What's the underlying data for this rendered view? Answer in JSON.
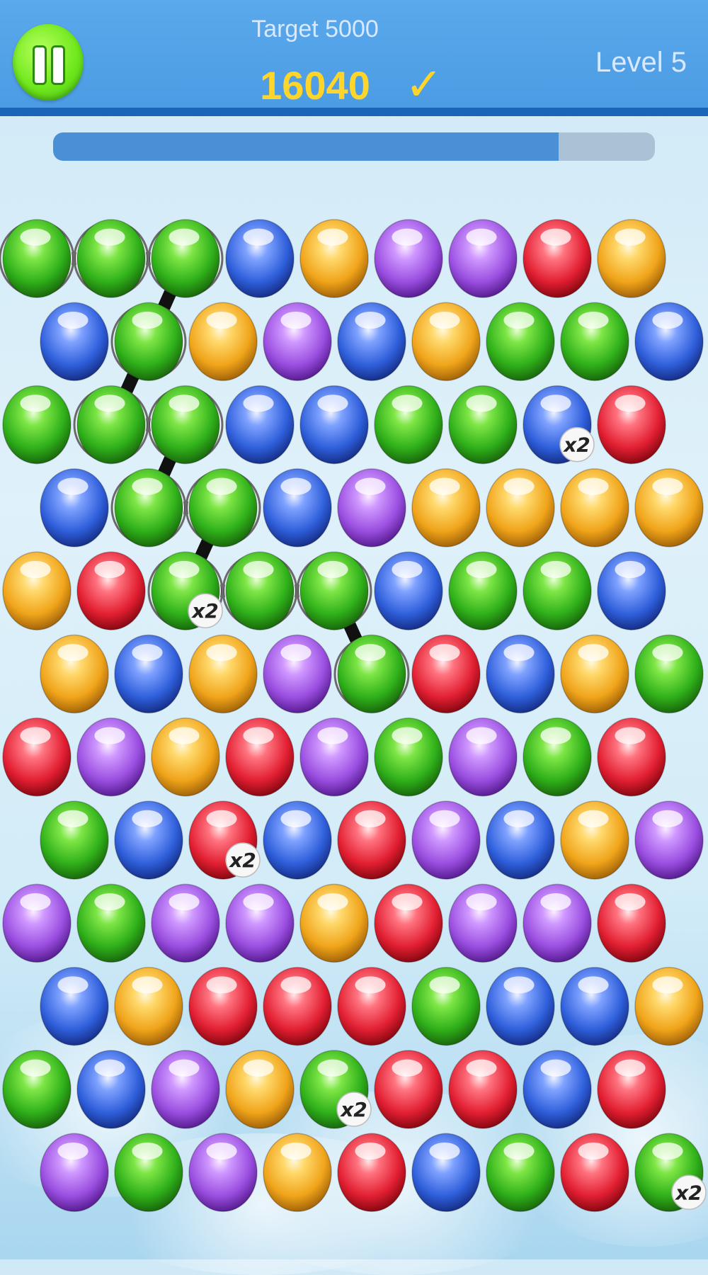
{
  "header": {
    "target_label": "Target 5000",
    "score": "16040",
    "check_symbol": "✓",
    "level_label": "Level 5",
    "pause_icon": "pause-icon"
  },
  "progress": {
    "fraction": 0.84
  },
  "colors": {
    "header_bg": "#4c9ce4",
    "header_border": "#1c64b8",
    "score": "#ffd52a",
    "progress_fill": "#4a90d6",
    "progress_track": "#a9c2d6",
    "green": "#3fbf1f",
    "blue": "#3f6fe0",
    "yellow": "#f2b92a",
    "purple": "#a85ee6",
    "red": "#e83040"
  },
  "board": {
    "rows": [
      [
        "g",
        "g",
        "g",
        "b",
        "y",
        "p",
        "p",
        "r",
        "y"
      ],
      [
        "b",
        "g",
        "y",
        "p",
        "b",
        "y",
        "g",
        "g",
        "b"
      ],
      [
        "g",
        "g",
        "g",
        "b",
        "b",
        "g",
        "g",
        "b",
        "r"
      ],
      [
        "b",
        "g",
        "g",
        "b",
        "p",
        "y",
        "y",
        "y",
        "y"
      ],
      [
        "y",
        "r",
        "g",
        "g",
        "g",
        "b",
        "g",
        "g",
        "b"
      ],
      [
        "y",
        "b",
        "y",
        "p",
        "g",
        "r",
        "b",
        "y",
        "g"
      ],
      [
        "r",
        "p",
        "y",
        "r",
        "p",
        "g",
        "p",
        "g",
        "r"
      ],
      [
        "g",
        "b",
        "r",
        "b",
        "r",
        "p",
        "b",
        "y",
        "p"
      ],
      [
        "p",
        "g",
        "p",
        "p",
        "y",
        "r",
        "p",
        "p",
        "r"
      ],
      [
        "b",
        "y",
        "r",
        "r",
        "r",
        "g",
        "b",
        "b",
        "y"
      ],
      [
        "g",
        "b",
        "p",
        "y",
        "g",
        "r",
        "r",
        "b",
        "r"
      ],
      [
        "p",
        "g",
        "p",
        "y",
        "r",
        "b",
        "g",
        "r",
        "g"
      ]
    ],
    "multiplier_label": "x2",
    "multipliers": [
      [
        2,
        7
      ],
      [
        4,
        2
      ],
      [
        7,
        2
      ],
      [
        10,
        4
      ],
      [
        11,
        8
      ]
    ],
    "selected_path": [
      [
        0,
        0
      ],
      [
        0,
        1
      ],
      [
        0,
        2
      ],
      [
        1,
        1
      ],
      [
        2,
        1
      ],
      [
        2,
        2
      ],
      [
        3,
        1
      ],
      [
        3,
        2
      ],
      [
        4,
        2
      ],
      [
        4,
        3
      ],
      [
        4,
        4
      ],
      [
        5,
        4
      ]
    ]
  }
}
